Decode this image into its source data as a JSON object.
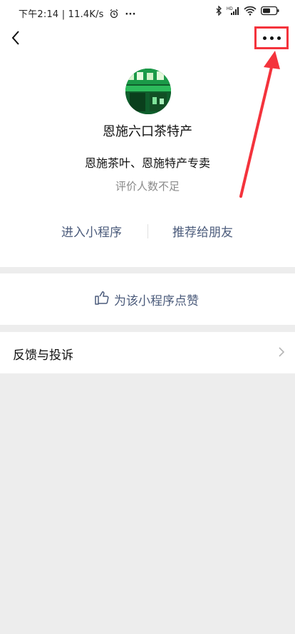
{
  "status_bar": {
    "left_text": "下午2:14 | 11.4K/s",
    "icons": [
      "alarm-icon",
      "more-dots-icon",
      "bluetooth-icon",
      "hd-signal-icon",
      "signal-icon",
      "wifi-icon",
      "battery-icon"
    ]
  },
  "nav": {
    "back_icon": "back-arrow-icon",
    "more_icon": "more-icon"
  },
  "profile": {
    "name": "恩施六口茶特产",
    "description": "恩施茶叶、恩施特产专卖",
    "rating_text": "评价人数不足"
  },
  "actions": {
    "enter_label": "进入小程序",
    "recommend_label": "推荐给朋友"
  },
  "like": {
    "label": "为该小程序点赞",
    "icon": "thumbs-up-icon"
  },
  "feedback": {
    "label": "反馈与投诉",
    "icon": "chevron-right-icon"
  },
  "colors": {
    "highlight": "#f4333c",
    "link": "#4b5b7b",
    "background": "#ededed"
  }
}
